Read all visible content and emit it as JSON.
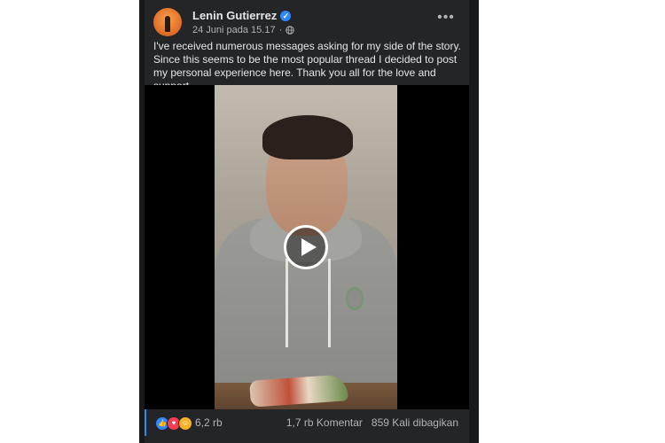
{
  "post": {
    "author": "Lenin Gutierrez",
    "date": "24 Juni pada 15.17",
    "separator": "·",
    "more_icon": "more-horizontal-icon",
    "text": "I've received numerous messages asking for my side of the story. Since this seems to be the most popular thread I decided to post my personal experience here. Thank you all for the love and support."
  },
  "footer": {
    "reaction_count": "6,2 rb",
    "comments": "1,7 rb Komentar",
    "shares": "859 Kali dibagikan"
  },
  "colors": {
    "card_bg": "#242526",
    "text_primary": "#e4e6eb",
    "text_secondary": "#b0b3b8",
    "accent": "#2d88ff"
  }
}
